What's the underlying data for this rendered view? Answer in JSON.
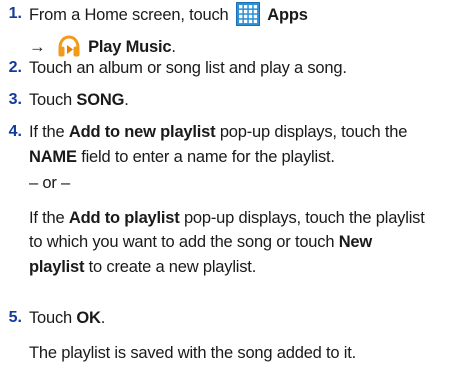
{
  "steps": [
    {
      "number": "1.",
      "text_before": "From a Home screen, touch",
      "apps_label": "Apps",
      "arrow": "→",
      "play_music_label": "Play Music",
      "period": "."
    },
    {
      "number": "2.",
      "text": "Touch an album or song list and play a song."
    },
    {
      "number": "3.",
      "text_before": "Touch",
      "bold": "SONG",
      "text_after": "."
    },
    {
      "number": "4.",
      "line1_before": "If the",
      "line1_bold": "Add to new playlist",
      "line1_after": "pop-up displays, touch the",
      "line2_bold": "NAME",
      "line2_after": "field to enter a name for the playlist.",
      "or": "– or –",
      "alt_line1_before": "If the",
      "alt_line1_bold": "Add to playlist",
      "alt_line1_after": "pop-up displays, touch the playlist",
      "alt_line2_before": "to which you want to add the song or touch",
      "alt_line2_bold": "New",
      "alt_line3_bold": "playlist",
      "alt_line3_after": "to create a new playlist."
    },
    {
      "number": "5.",
      "text_before": "Touch",
      "bold": "OK",
      "text_after": ".",
      "result": "The playlist is saved with the song added to it."
    }
  ],
  "icons": {
    "apps": "apps-grid-icon",
    "play_music": "headphones-icon"
  },
  "colors": {
    "step_number": "#123a9a",
    "apps_icon": "#2b8fd6",
    "play_music_icon": "#f29a1a"
  }
}
